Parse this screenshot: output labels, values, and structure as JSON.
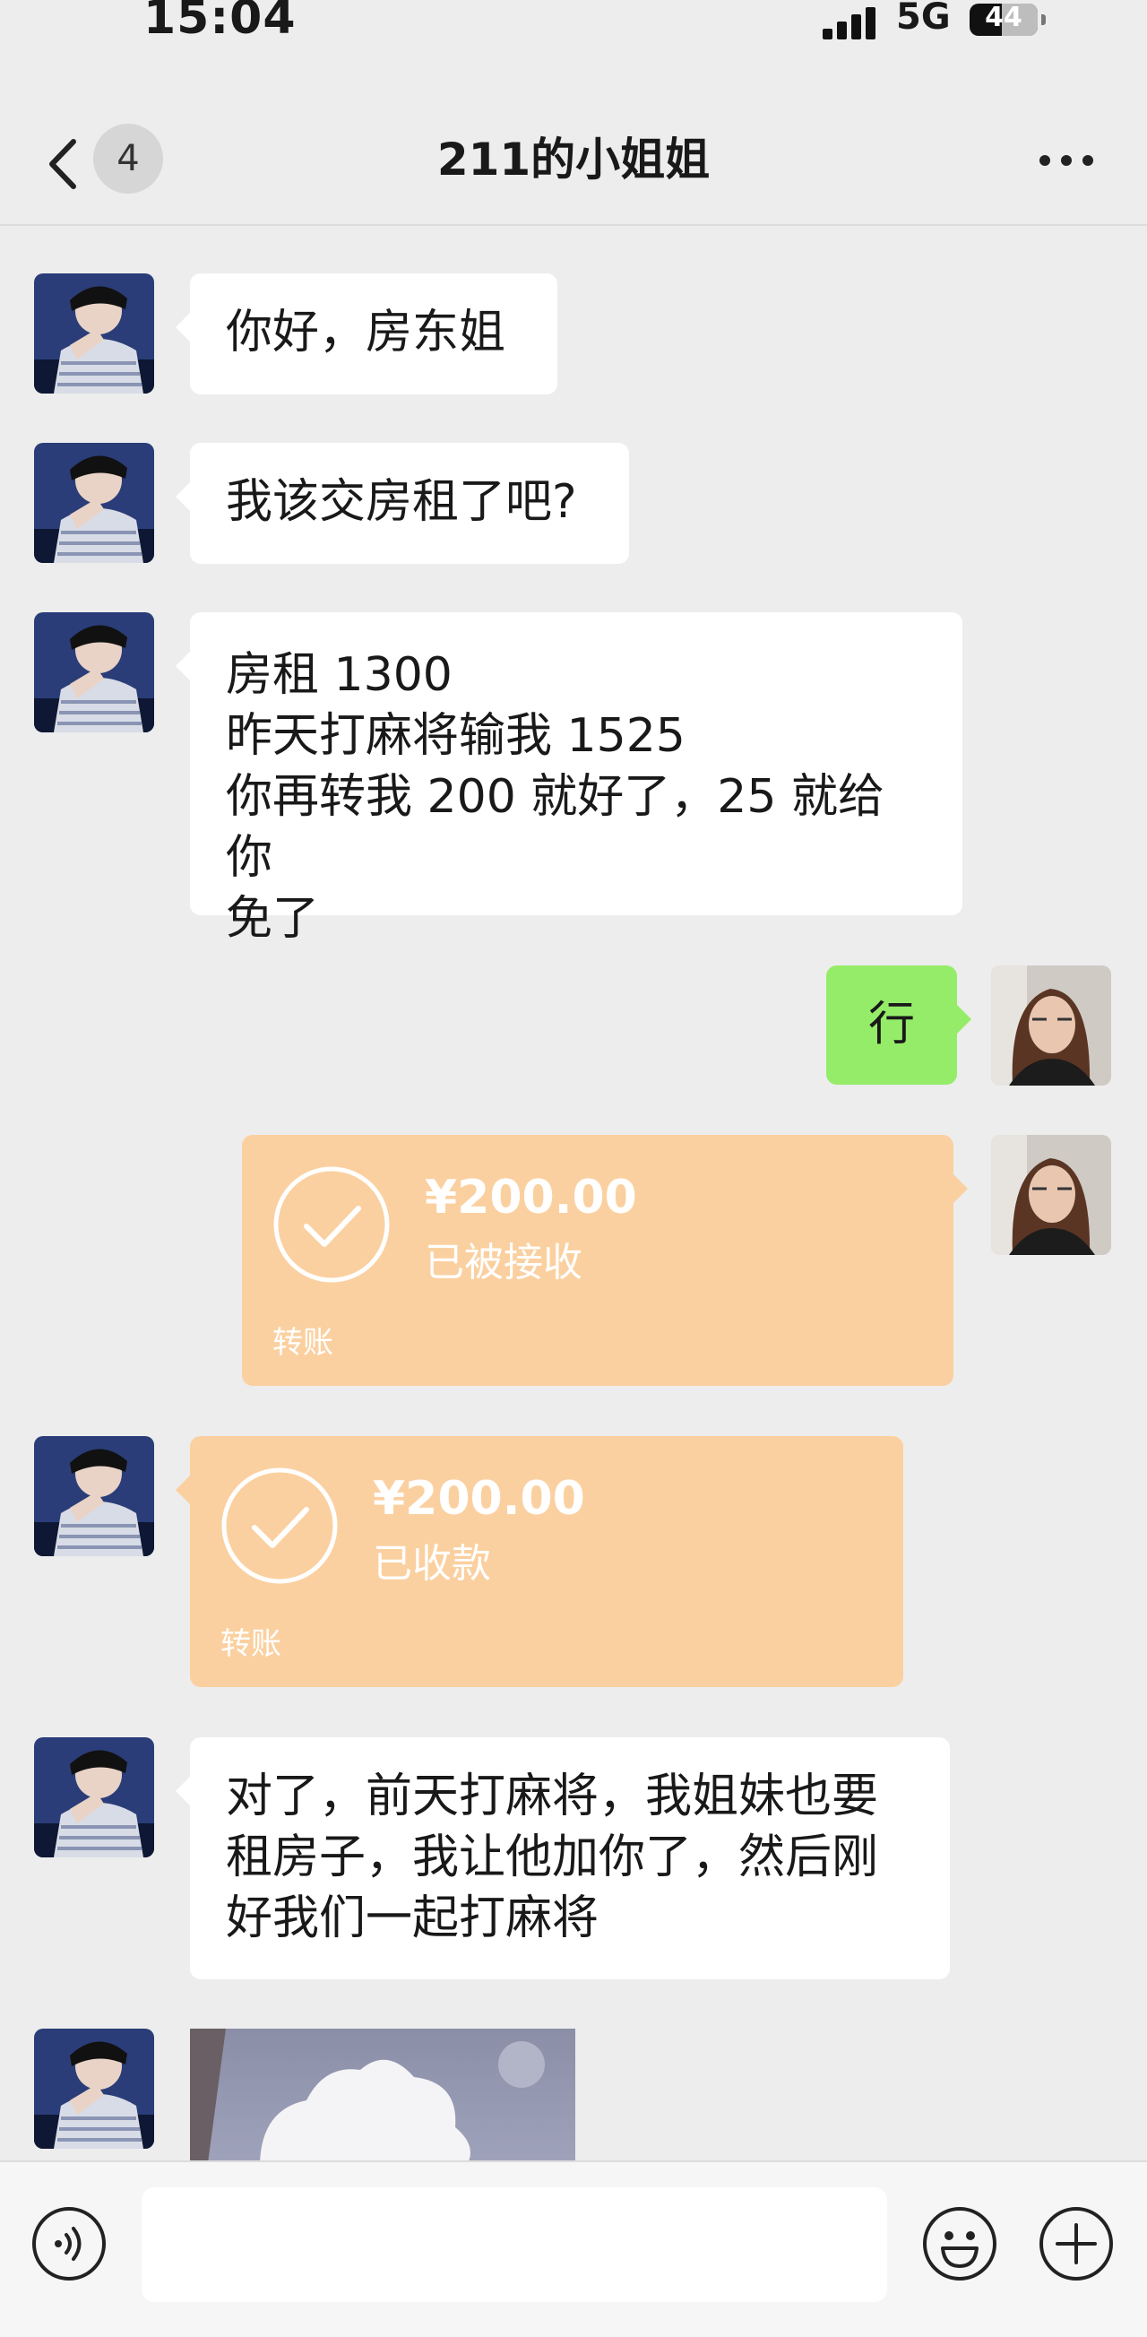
{
  "status_bar": {
    "time": "15:04",
    "network": "5G",
    "battery": "44",
    "battery_level": 0.44
  },
  "header": {
    "unread_count": "4",
    "title": "211的小姐姐"
  },
  "messages": [
    {
      "side": "left",
      "text": "你好，房东姐"
    },
    {
      "side": "left",
      "text": "我该交房租了吧?"
    },
    {
      "side": "left",
      "lines": [
        "房租 1300",
        "昨天打麻将输我 1525",
        "你再转我 200 就好了，25 就给你",
        "免了"
      ]
    },
    {
      "side": "right",
      "text": "行"
    },
    {
      "side": "right",
      "type": "transfer",
      "amount": "¥200.00",
      "status": "已被接收",
      "label": "转账"
    },
    {
      "side": "left",
      "type": "transfer",
      "amount": "¥200.00",
      "status": "已收款",
      "label": "转账"
    },
    {
      "side": "left",
      "lines": [
        "对了，前天打麻将，我姐妹也要",
        "租房子，我让他加你了，然后刚",
        "好我们一起打麻将"
      ]
    },
    {
      "side": "left",
      "type": "image"
    }
  ],
  "input": {
    "value": ""
  },
  "icons": {
    "back": "chevron-left-icon",
    "more": "more-dots-icon",
    "voice": "voice-icon",
    "emoji": "emoji-icon",
    "plus": "plus-icon"
  },
  "colors": {
    "background": "#ededed",
    "incoming_bubble": "#ffffff",
    "outgoing_bubble": "#95ec69",
    "transfer": "#fbd0a0"
  }
}
